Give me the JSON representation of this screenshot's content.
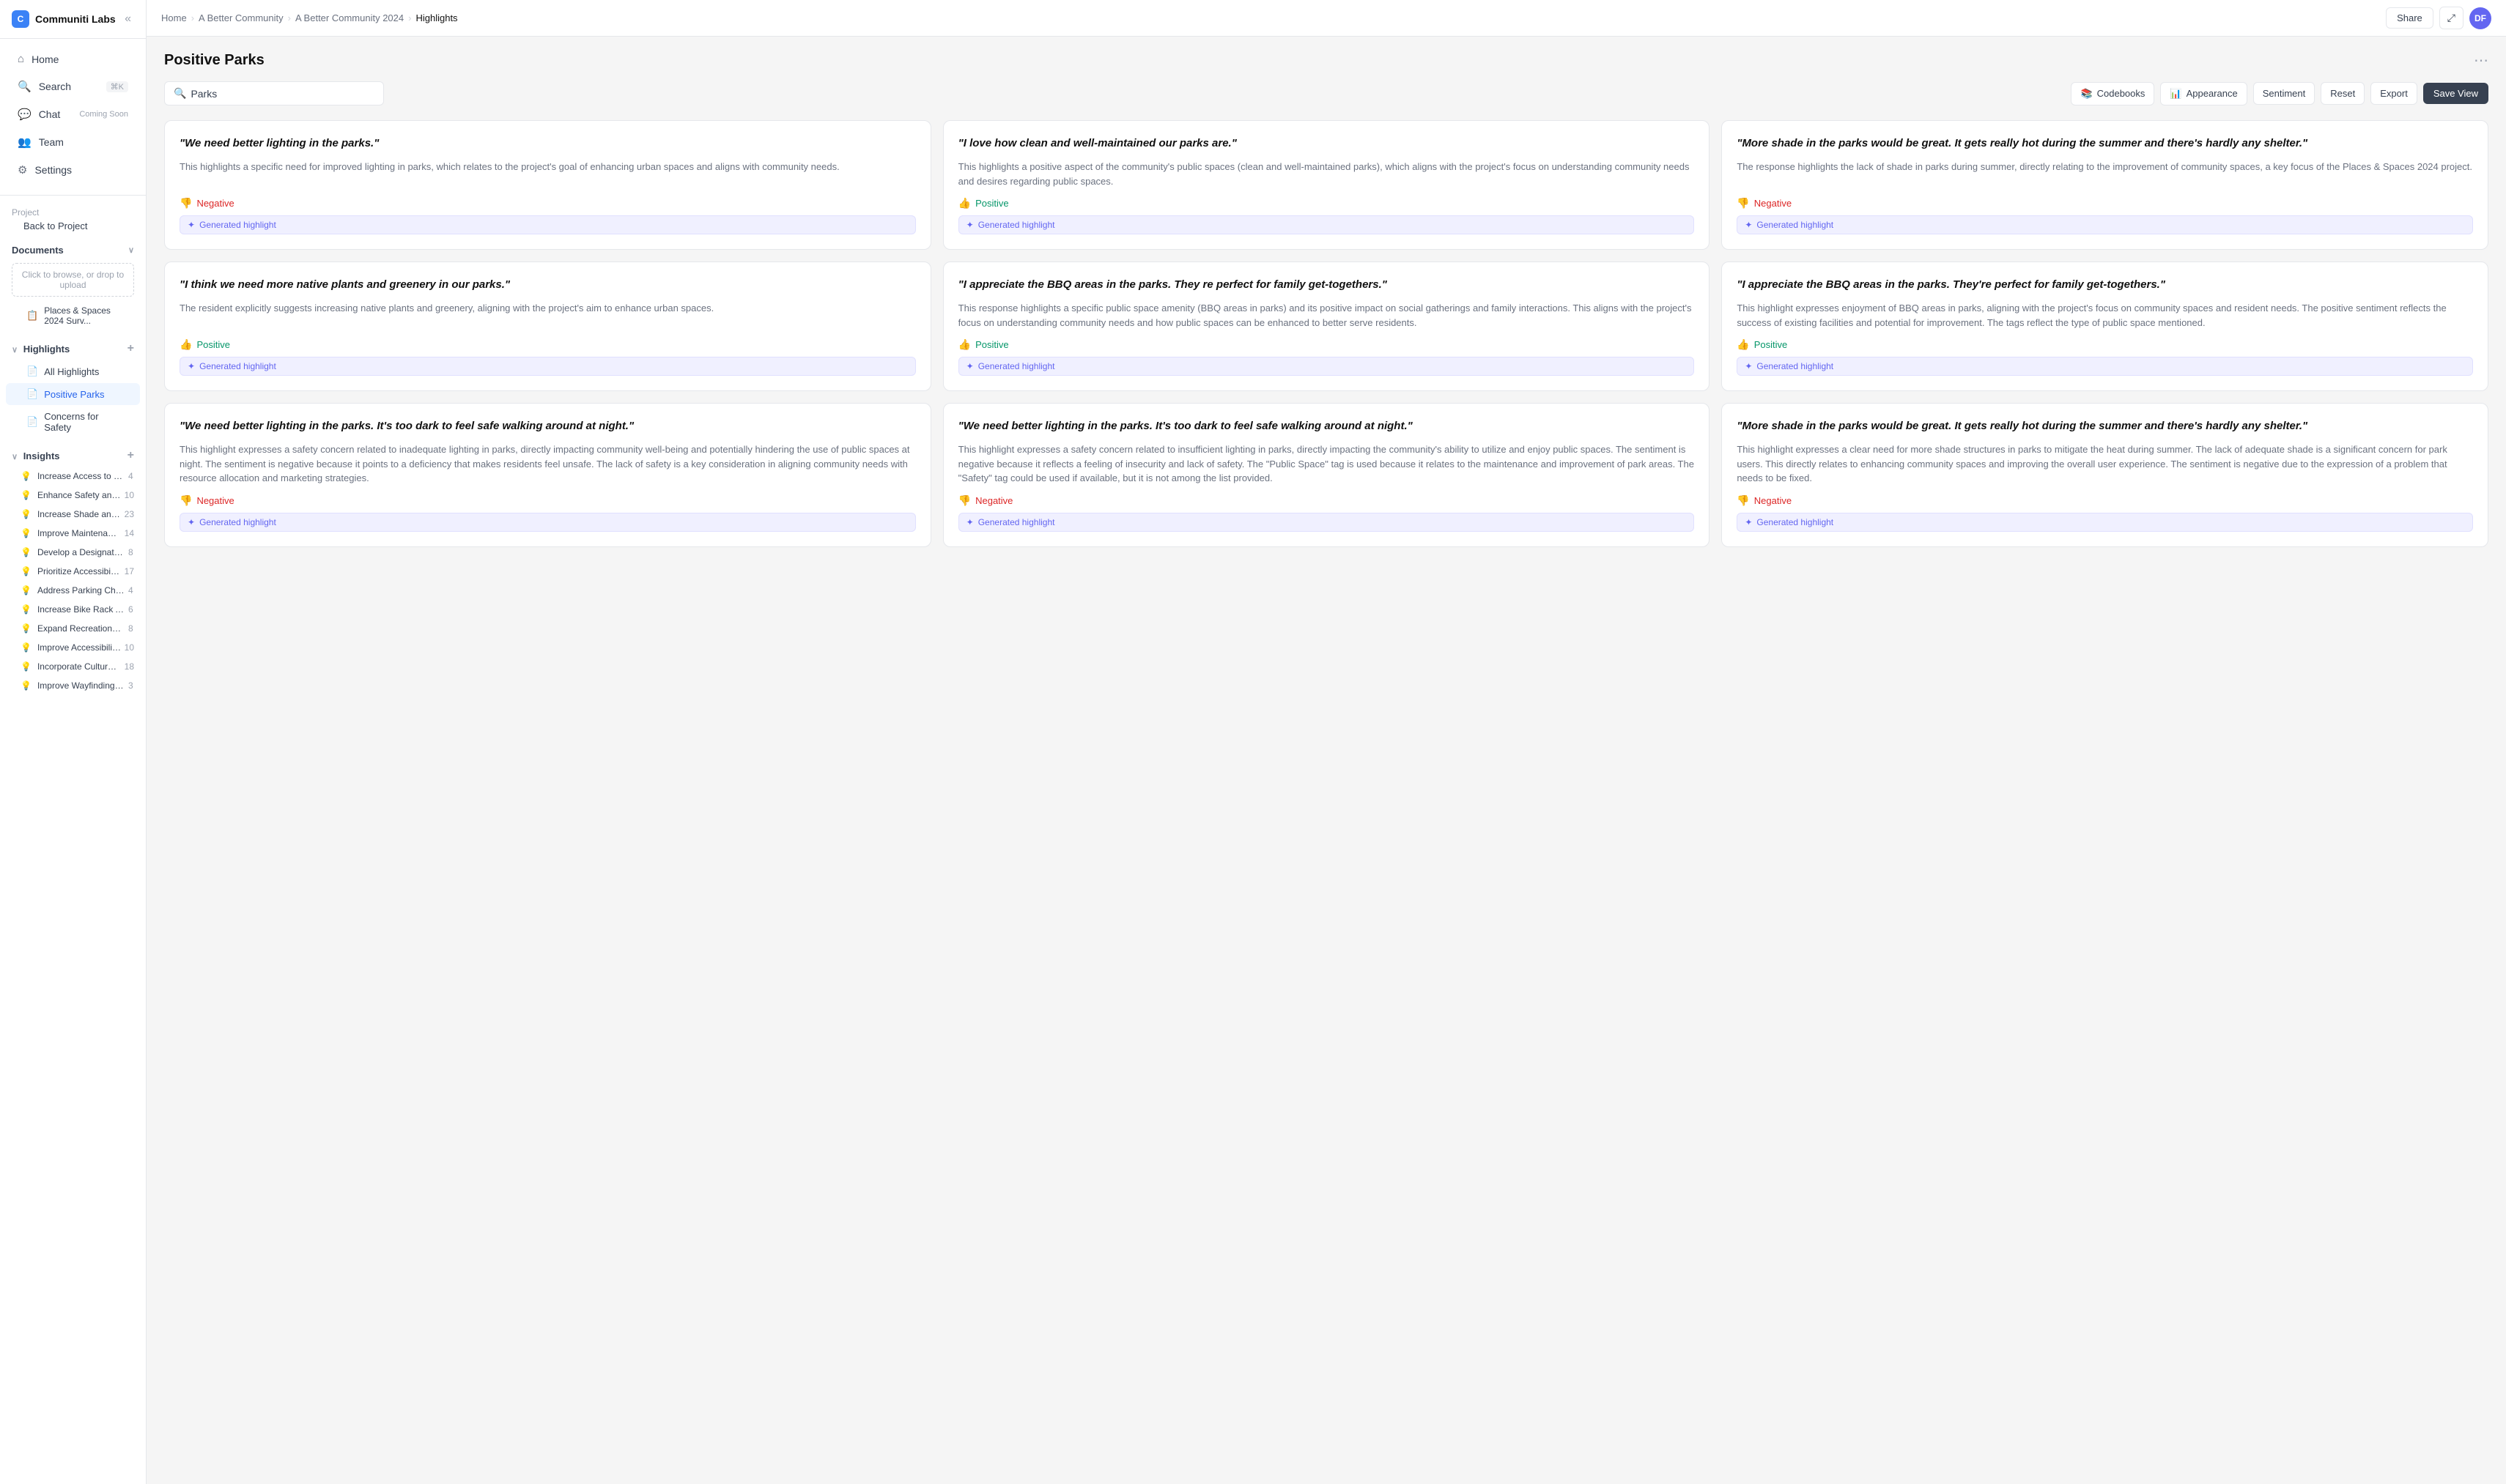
{
  "sidebar": {
    "logo": "Communiti Labs",
    "logo_initial": "C",
    "nav": [
      {
        "label": "Home",
        "icon": "⌂",
        "active": false
      },
      {
        "label": "Search",
        "icon": "⌕",
        "badge": "⌘K",
        "active": false
      },
      {
        "label": "Chat",
        "icon": "○",
        "badge_text": "Coming Soon",
        "active": false
      },
      {
        "label": "Team",
        "icon": "◻",
        "active": false
      },
      {
        "label": "Settings",
        "icon": "⚙",
        "active": false
      }
    ],
    "project_section": "Project",
    "back_to_project": "Back to Project",
    "documents_label": "Documents",
    "upload_label": "Click to browse, or drop to upload",
    "file_label": "Places & Spaces 2024 Surv...",
    "highlights_label": "Highlights",
    "highlight_items": [
      {
        "label": "All Highlights",
        "icon": "▤"
      },
      {
        "label": "Positive Parks",
        "icon": "▤",
        "active": true
      },
      {
        "label": "Concerns for Safety",
        "icon": "▤"
      }
    ],
    "insights_label": "Insights",
    "insight_items": [
      {
        "label": "Increase Access to Dri...",
        "count": 4
      },
      {
        "label": "Enhance Safety and E...",
        "count": 10
      },
      {
        "label": "Increase Shade and S...",
        "count": 23
      },
      {
        "label": "Improve Maintenance ...",
        "count": 14
      },
      {
        "label": "Develop a Designated ...",
        "count": 8
      },
      {
        "label": "Prioritize Accessibility ...",
        "count": 17
      },
      {
        "label": "Address Parking Challe...",
        "count": 4
      },
      {
        "label": "Increase Bike Rack Ava...",
        "count": 6
      },
      {
        "label": "Expand Recreational O...",
        "count": 8
      },
      {
        "label": "Improve Accessibility t...",
        "count": 10
      },
      {
        "label": "Incorporate Culturally ...",
        "count": 18
      },
      {
        "label": "Improve Wayfinding wit...",
        "count": 3
      }
    ]
  },
  "topbar": {
    "breadcrumb": [
      "Home",
      "A Better Community",
      "A Better Community 2024",
      "Highlights"
    ],
    "share_label": "Share",
    "avatar_initials": "DF"
  },
  "content": {
    "title": "Positive Parks",
    "search_placeholder": "Parks",
    "filters": {
      "codebooks": "Codebooks",
      "appearance": "Appearance",
      "sentiment": "Sentiment",
      "reset": "Reset",
      "export": "Export",
      "save_view": "Save View"
    },
    "cards": [
      {
        "quote": "\"We need better lighting in the parks.\"",
        "body": "This highlights a specific need for improved lighting in parks, which relates to the project's goal of enhancing urban spaces and aligns with community needs.",
        "sentiment": "Negative",
        "sentiment_type": "negative",
        "tag": "Generated highlight"
      },
      {
        "quote": "\"I love how clean and well-maintained our parks are.\"",
        "body": "This highlights a positive aspect of the community's public spaces (clean and well-maintained parks), which aligns with the project's focus on understanding community needs and desires regarding public spaces.",
        "sentiment": "Positive",
        "sentiment_type": "positive",
        "tag": "Generated highlight"
      },
      {
        "quote": "\"More shade in the parks would be great. It gets really hot during the summer and there's hardly any shelter.\"",
        "body": "The response highlights the lack of shade in parks during summer, directly relating to the improvement of community spaces, a key focus of the Places & Spaces 2024 project.",
        "sentiment": "Negative",
        "sentiment_type": "negative",
        "tag": "Generated highlight"
      },
      {
        "quote": "\"I think we need more native plants and greenery in our parks.\"",
        "body": "The resident explicitly suggests increasing native plants and greenery, aligning with the project's aim to enhance urban spaces.",
        "sentiment": "Positive",
        "sentiment_type": "positive",
        "tag": "Generated highlight"
      },
      {
        "quote": "\"I appreciate the BBQ areas in the parks. They re perfect for family get-togethers.\"",
        "body": "This response highlights a specific public space amenity (BBQ areas in parks) and its positive impact on social gatherings and family interactions. This aligns with the project's focus on understanding community needs and how public spaces can be enhanced to better serve residents.",
        "sentiment": "Positive",
        "sentiment_type": "positive",
        "tag": "Generated highlight"
      },
      {
        "quote": "\"I appreciate the BBQ areas in the parks. They're perfect for family get-togethers.\"",
        "body": "This highlight expresses enjoyment of BBQ areas in parks, aligning with the project's focus on community spaces and resident needs. The positive sentiment reflects the success of existing facilities and potential for improvement. The tags reflect the type of public space mentioned.",
        "sentiment": "Positive",
        "sentiment_type": "positive",
        "tag": "Generated highlight"
      },
      {
        "quote": "\"We need better lighting in the parks. It's too dark to feel safe walking around at night.\"",
        "body": "This highlight expresses a safety concern related to inadequate lighting in parks, directly impacting community well-being and potentially hindering the use of public spaces at night. The sentiment is negative because it points to a deficiency that makes residents feel unsafe. The lack of safety is a key consideration in aligning community needs with resource allocation and marketing strategies.",
        "sentiment": "Negative",
        "sentiment_type": "negative",
        "tag": "Generated highlight"
      },
      {
        "quote": "\"We need better lighting in the parks. It's too dark to feel safe walking around at night.\"",
        "body": "This highlight expresses a safety concern related to insufficient lighting in parks, directly impacting the community's ability to utilize and enjoy public spaces. The sentiment is negative because it reflects a feeling of insecurity and lack of safety. The \"Public Space\" tag is used because it relates to the maintenance and improvement of park areas. The \"Safety\" tag could be used if available, but it is not among the list provided.",
        "sentiment": "Negative",
        "sentiment_type": "negative",
        "tag": "Generated highlight"
      },
      {
        "quote": "\"More shade in the parks would be great. It gets really hot during the summer and there's hardly any shelter.\"",
        "body": "This highlight expresses a clear need for more shade structures in parks to mitigate the heat during summer. The lack of adequate shade is a significant concern for park users. This directly relates to enhancing community spaces and improving the overall user experience. The sentiment is negative due to the expression of a problem that needs to be fixed.",
        "sentiment": "Negative",
        "sentiment_type": "negative",
        "tag": "Generated highlight"
      }
    ]
  }
}
